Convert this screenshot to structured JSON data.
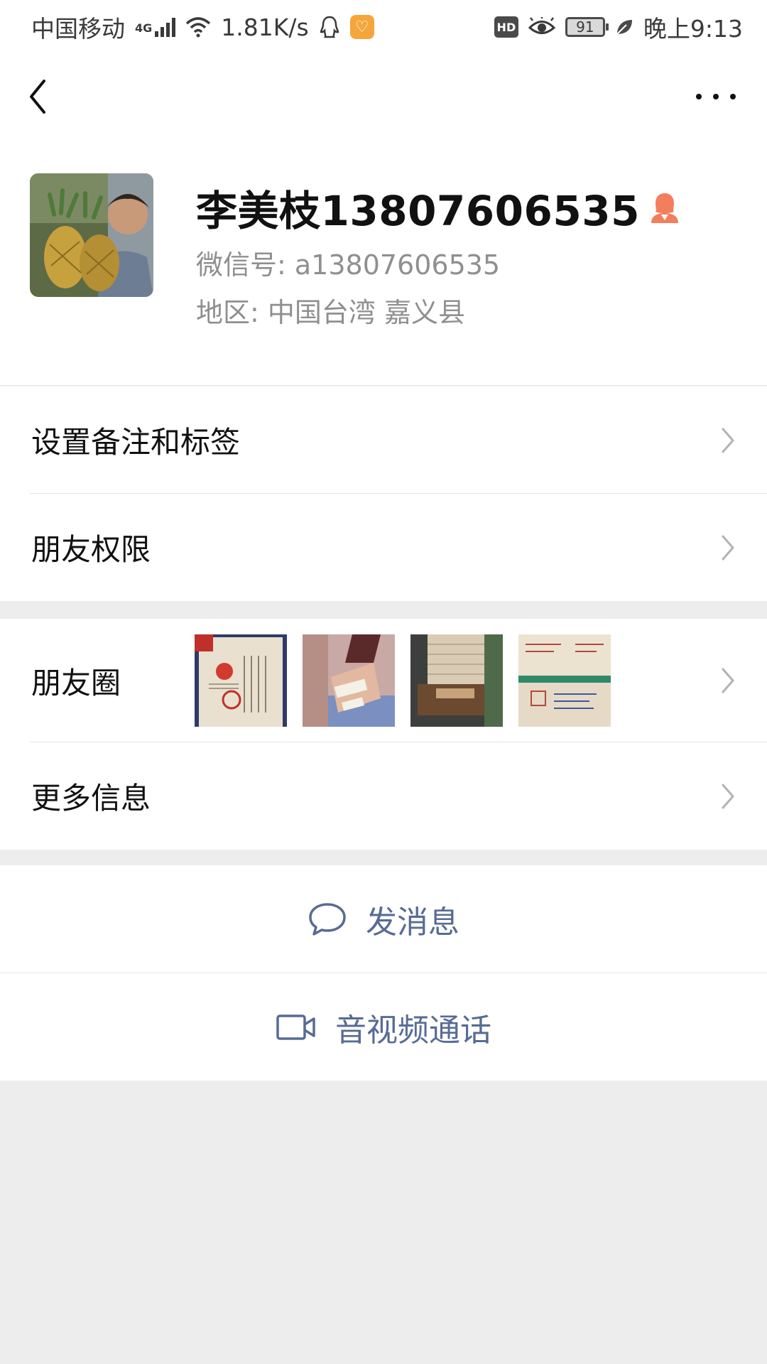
{
  "status_bar": {
    "carrier": "中国移动",
    "network_type": "4G",
    "net_speed": "1.81K/s",
    "battery": "91",
    "time": "晚上9:13",
    "icons": [
      "signal-icon",
      "wifi-icon",
      "qq-icon",
      "app-badge-icon",
      "hd-icon",
      "eye-icon",
      "battery-icon",
      "leaf-icon"
    ]
  },
  "nav": {
    "back_icon": "back-chevron-icon",
    "more_icon": "more-icon"
  },
  "profile": {
    "name": "李美枝13807606535",
    "gender_icon": "female-icon",
    "gender_color": "#f37e5e",
    "wechat_id": "微信号:  a13807606535",
    "region": "地区:  中国台湾  嘉义县"
  },
  "menu": {
    "remark_label": "设置备注和标签",
    "permissions_label": "朋友权限",
    "moments_label": "朋友圈",
    "more_info_label": "更多信息"
  },
  "actions": {
    "message_label": "发消息",
    "call_label": "音视频通话",
    "accent_color": "#576b95"
  },
  "colors": {
    "page_background": "#ededed",
    "text_primary": "#111111",
    "text_secondary": "#8f8f8f",
    "divider": "#e5e5e5"
  }
}
